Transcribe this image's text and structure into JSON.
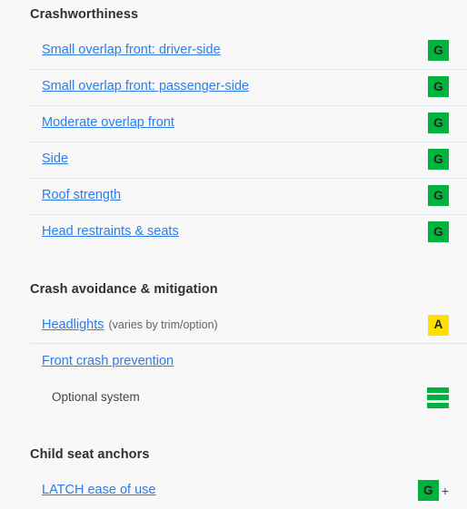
{
  "sections": [
    {
      "heading": "Crashworthiness",
      "rows": [
        {
          "label": "Small overlap front: driver-side",
          "note": "",
          "rating": "G",
          "rating_kind": "badge-good",
          "plus": "",
          "divider": false,
          "sub": false
        },
        {
          "label": "Small overlap front: passenger-side",
          "note": "",
          "rating": "G",
          "rating_kind": "badge-good",
          "plus": "",
          "divider": true,
          "sub": false
        },
        {
          "label": "Moderate overlap front",
          "note": "",
          "rating": "G",
          "rating_kind": "badge-good",
          "plus": "",
          "divider": true,
          "sub": false
        },
        {
          "label": "Side",
          "note": "",
          "rating": "G",
          "rating_kind": "badge-good",
          "plus": "",
          "divider": true,
          "sub": false
        },
        {
          "label": "Roof strength",
          "note": "",
          "rating": "G",
          "rating_kind": "badge-good",
          "plus": "",
          "divider": true,
          "sub": false
        },
        {
          "label": "Head restraints & seats",
          "note": "",
          "rating": "G",
          "rating_kind": "badge-good",
          "plus": "",
          "divider": true,
          "sub": false
        }
      ]
    },
    {
      "heading": "Crash avoidance & mitigation",
      "rows": [
        {
          "label": "Headlights",
          "note": "(varies by trim/option)",
          "rating": "A",
          "rating_kind": "badge-acceptable",
          "plus": "",
          "divider": false,
          "sub": false
        },
        {
          "label": "Front crash prevention",
          "note": "",
          "rating": "",
          "rating_kind": "none",
          "plus": "",
          "divider": true,
          "sub": false
        },
        {
          "label": "Optional system",
          "note": "",
          "rating": "",
          "rating_kind": "bars",
          "plus": "",
          "divider": false,
          "sub": true
        }
      ]
    },
    {
      "heading": "Child seat anchors",
      "rows": [
        {
          "label": "LATCH ease of use",
          "note": "",
          "rating": "G",
          "rating_kind": "badge-good",
          "plus": "+",
          "divider": false,
          "sub": false
        }
      ]
    }
  ],
  "colors": {
    "good": "#00b33c",
    "acceptable": "#ffe000",
    "link": "#2b7de9",
    "heading": "#2f2f2f",
    "background": "#f8f8f8",
    "divider": "#e4e4e4"
  },
  "icons": {
    "bars": "bars-icon"
  }
}
